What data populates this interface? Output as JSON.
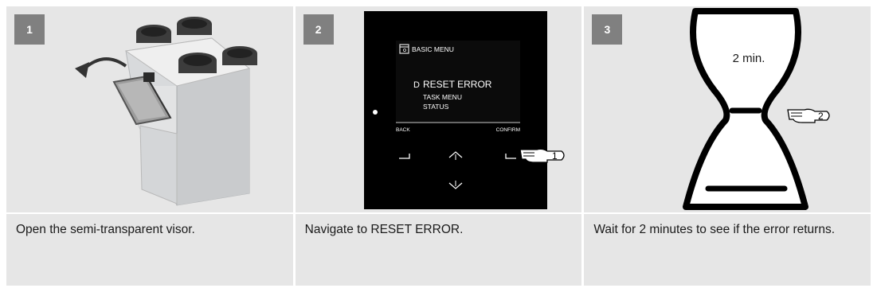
{
  "colors": {
    "panel": "#e6e6e6",
    "badge": "#808080",
    "text": "#1a1a1a",
    "display": "#000000"
  },
  "steps": [
    {
      "number": "1",
      "caption": "Open the semi-transparent visor."
    },
    {
      "number": "2",
      "caption": "Navigate to RESET ERROR.",
      "display": {
        "menu_title": "BASIC MENU",
        "cursor": "D",
        "items": [
          "RESET ERROR",
          "TASK MENU",
          "STATUS"
        ],
        "back": "BACK",
        "confirm": "CONFIRM",
        "press_count": "1"
      }
    },
    {
      "number": "3",
      "caption": "Wait for 2 minutes to see if the error returns.",
      "wait_label": "2 min.",
      "press_count": "2"
    }
  ]
}
